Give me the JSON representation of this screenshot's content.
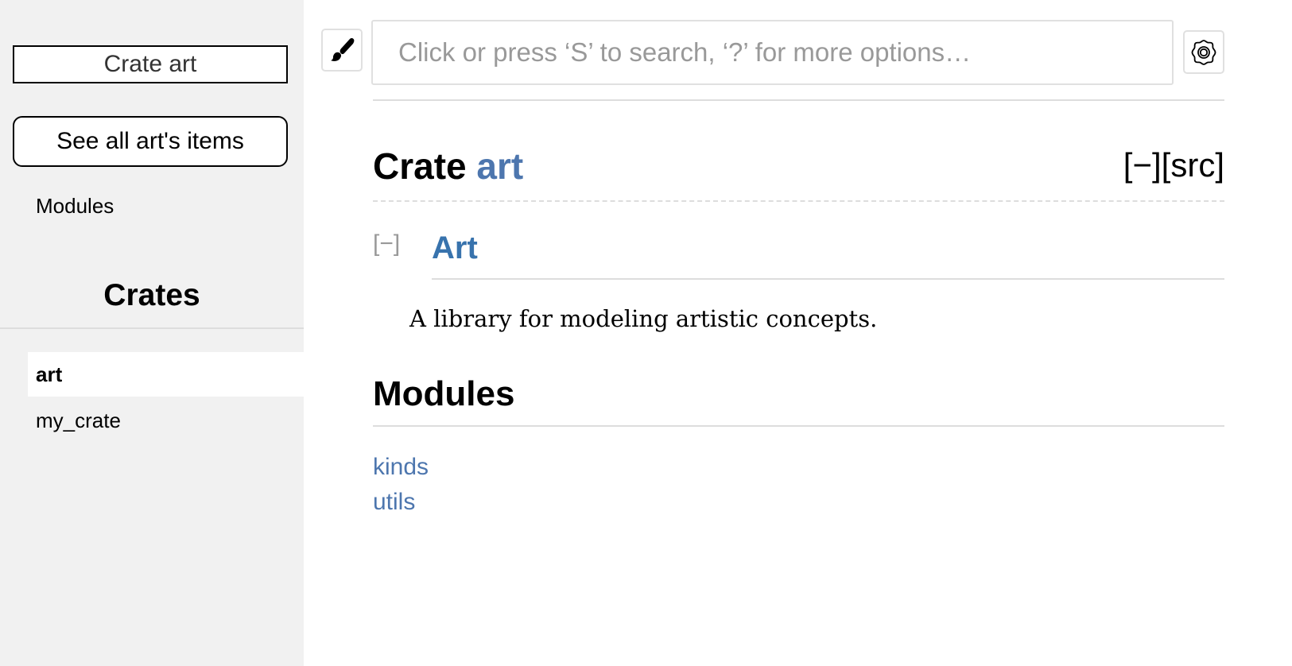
{
  "sidebar": {
    "crate_label": "Crate art",
    "all_items_label": "See all art's items",
    "modules_link": "Modules",
    "crates_title": "Crates",
    "crates": [
      {
        "name": "art",
        "active": true
      },
      {
        "name": "my_crate",
        "active": false
      }
    ]
  },
  "toolbar": {
    "theme_icon": "paintbrush-icon",
    "search_placeholder": "Click or press ‘S’ to search, ‘?’ for more options…",
    "search_value": "",
    "settings_icon": "gear-icon"
  },
  "main": {
    "title_prefix": "Crate ",
    "title_name": "art",
    "collapse_all": "[−]",
    "src_link": "[src]",
    "doc_toggle": "[−]",
    "doc_heading": "Art",
    "description": "A library for modeling artistic concepts.",
    "modules_heading": "Modules",
    "modules": [
      "kinds",
      "utils"
    ]
  },
  "colors": {
    "link": "#4d76ae",
    "heading_link": "#3873ad",
    "sidebar_bg": "#f1f1f1",
    "divider": "#dddddd",
    "placeholder": "#999999"
  }
}
